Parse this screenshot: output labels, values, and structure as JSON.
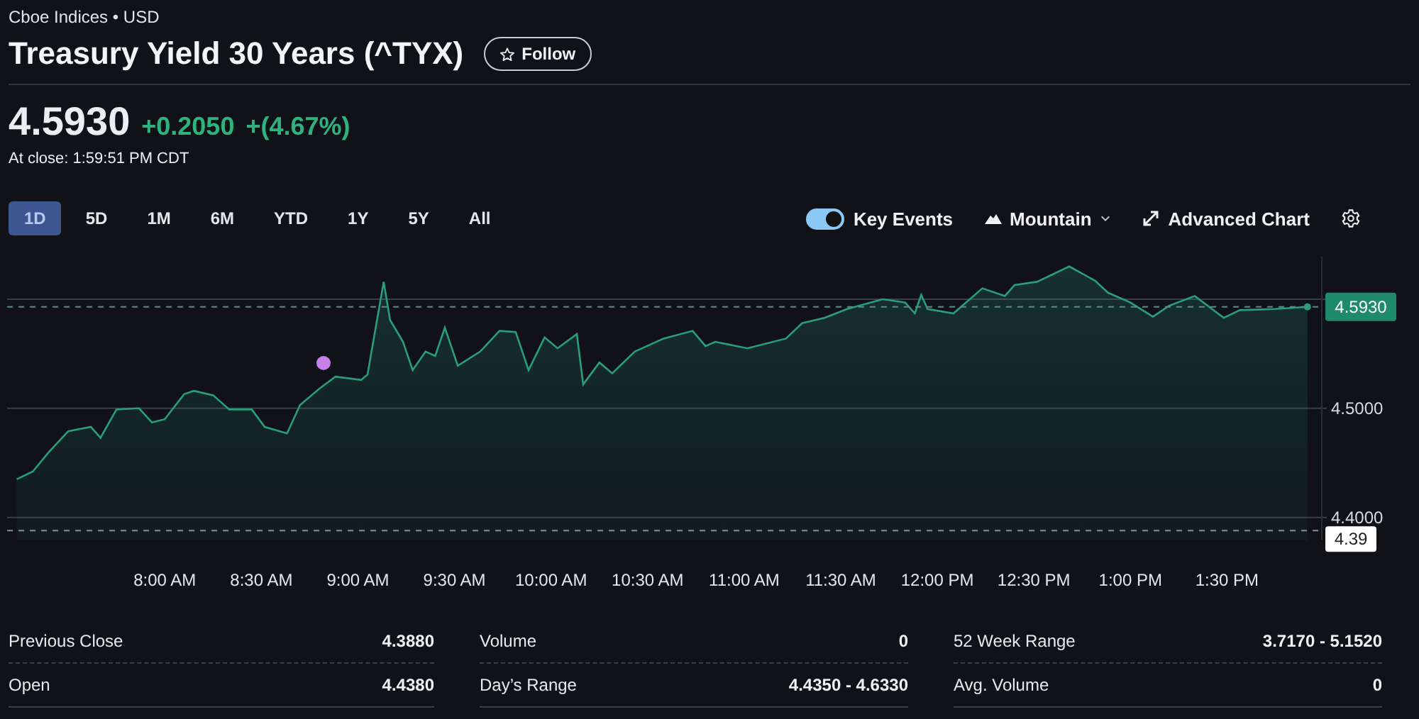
{
  "header": {
    "exchange": "Cboe Indices • USD",
    "title": "Treasury Yield 30 Years (^TYX)",
    "follow_button": "Follow"
  },
  "quote": {
    "price": "4.5930",
    "change": "+0.2050",
    "change_percent": "+(4.67%)",
    "close_time": "At close: 1:59:51 PM CDT"
  },
  "ranges": [
    {
      "label": "1D",
      "selected": true
    },
    {
      "label": "5D",
      "selected": false
    },
    {
      "label": "1M",
      "selected": false
    },
    {
      "label": "6M",
      "selected": false
    },
    {
      "label": "YTD",
      "selected": false
    },
    {
      "label": "1Y",
      "selected": false
    },
    {
      "label": "5Y",
      "selected": false
    },
    {
      "label": "All",
      "selected": false
    }
  ],
  "toolbar": {
    "key_events": {
      "label": "Key Events",
      "on": true
    },
    "chart_type": "Mountain",
    "advanced_chart": "Advanced Chart"
  },
  "chart": {
    "chart_data": {
      "type": "area",
      "x": [
        434,
        439,
        444,
        450,
        457,
        460,
        465,
        472,
        476,
        480,
        486,
        489,
        495,
        500,
        507,
        511,
        518,
        522,
        528,
        533,
        541,
        543,
        548,
        550,
        554,
        557,
        561,
        564,
        567,
        571,
        578,
        584,
        589,
        593,
        598,
        602,
        608,
        610,
        615,
        619,
        626,
        635,
        644,
        648,
        651,
        661,
        673,
        678,
        685,
        692,
        703,
        710,
        713,
        715,
        717,
        725,
        734,
        741,
        744,
        751,
        761,
        769,
        773,
        780,
        787,
        792,
        800,
        809,
        814,
        825,
        835
      ],
      "series": [
        {
          "color": "#2a9d7f",
          "values": [
            4.435,
            4.442,
            4.46,
            4.479,
            4.483,
            4.473,
            4.499,
            4.5,
            4.487,
            4.49,
            4.513,
            4.516,
            4.512,
            4.499,
            4.499,
            4.483,
            4.477,
            4.503,
            4.518,
            4.529,
            4.526,
            4.531,
            4.616,
            4.581,
            4.561,
            4.535,
            4.552,
            4.548,
            4.574,
            4.539,
            4.552,
            4.571,
            4.57,
            4.535,
            4.565,
            4.555,
            4.568,
            4.522,
            4.542,
            4.532,
            4.552,
            4.564,
            4.571,
            4.557,
            4.561,
            4.555,
            4.564,
            4.578,
            4.583,
            4.591,
            4.6,
            4.597,
            4.587,
            4.604,
            4.591,
            4.587,
            4.61,
            4.603,
            4.613,
            4.616,
            4.63,
            4.617,
            4.606,
            4.597,
            4.584,
            4.594,
            4.603,
            4.583,
            4.59,
            4.591,
            4.593
          ]
        }
      ],
      "xlim": [
        431,
        841
      ],
      "ylim": [
        4.379,
        4.639
      ],
      "grid": true,
      "xticks": [
        {
          "value": 480,
          "label": "8:00 AM"
        },
        {
          "value": 510,
          "label": "8:30 AM"
        },
        {
          "value": 540,
          "label": "9:00 AM"
        },
        {
          "value": 570,
          "label": "9:30 AM"
        },
        {
          "value": 600,
          "label": "10:00 AM"
        },
        {
          "value": 630,
          "label": "10:30 AM"
        },
        {
          "value": 660,
          "label": "11:00 AM"
        },
        {
          "value": 690,
          "label": "11:30 AM"
        },
        {
          "value": 720,
          "label": "12:00 PM"
        },
        {
          "value": 750,
          "label": "12:30 PM"
        },
        {
          "value": 780,
          "label": "1:00 PM"
        },
        {
          "value": 810,
          "label": "1:30 PM"
        }
      ],
      "yticks": [
        {
          "value": 4.4,
          "label": "4.4000"
        },
        {
          "value": 4.5,
          "label": "4.5000"
        }
      ],
      "ref_lines": [
        {
          "axis": "y",
          "value": 4.593,
          "label": "4.5930",
          "color": "#5d8c82"
        },
        {
          "axis": "y",
          "value": 4.388,
          "label": "4.39",
          "color": "#8a8d93"
        }
      ]
    }
  },
  "stats": [
    {
      "label": "Previous Close",
      "value": "4.3880"
    },
    {
      "label": "Volume",
      "value": "0"
    },
    {
      "label": "52 Week Range",
      "value": "3.7170 - 5.1520"
    },
    {
      "label": "Open",
      "value": "4.4380"
    },
    {
      "label": "Day’s Range",
      "value": "4.4350 - 4.6330"
    },
    {
      "label": "Avg. Volume",
      "value": "0"
    }
  ]
}
